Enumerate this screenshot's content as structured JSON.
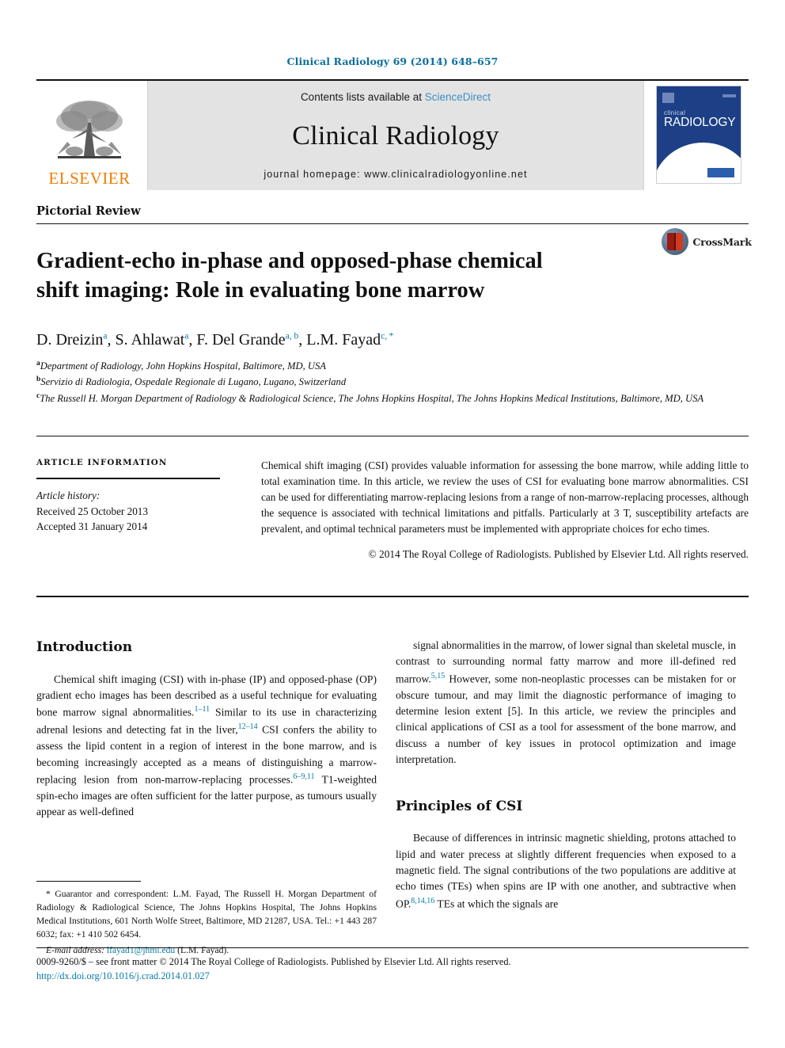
{
  "running_head": "Clinical Radiology 69 (2014) 648–657",
  "masthead": {
    "publisher_word": "ELSEVIER",
    "contents_prefix": "Contents lists available at ",
    "contents_link": "ScienceDirect",
    "journal_name": "Clinical Radiology",
    "homepage": "journal homepage: www.clinicalradiologyonline.net",
    "cover": {
      "small_word": "clinical",
      "big_word": "RADIOLOGY"
    }
  },
  "article": {
    "type": "Pictorial Review",
    "title": "Gradient-echo in-phase and opposed-phase chemical shift imaging: Role in evaluating bone marrow",
    "crossmark_label": "CrossMark",
    "authors_html": "D. Dreizin<sup>a</sup>, S. Ahlawat<sup>a</sup>, F. Del Grande<sup>a, b</sup>, L.M. Fayad<sup>c, *</sup>",
    "affiliations": [
      "Department of Radiology, John Hopkins Hospital, Baltimore, MD, USA",
      "Servizio di Radiologia, Ospedale Regionale di Lugano, Lugano, Switzerland",
      "The Russell H. Morgan Department of Radiology & Radiological Science, The Johns Hopkins Hospital, The Johns Hopkins Medical Institutions, Baltimore, MD, USA"
    ],
    "affiliation_marks": [
      "a",
      "b",
      "c"
    ]
  },
  "article_information": {
    "heading": "ARTICLE INFORMATION",
    "history_label": "Article history:",
    "received": "Received 25 October 2013",
    "accepted": "Accepted 31 January 2014"
  },
  "abstract": {
    "text": "Chemical shift imaging (CSI) provides valuable information for assessing the bone marrow, while adding little to total examination time. In this article, we review the uses of CSI for evaluating bone marrow abnormalities. CSI can be used for differentiating marrow-replacing lesions from a range of non-marrow-replacing processes, although the sequence is associated with technical limitations and pitfalls. Particularly at 3 T, susceptibility artefacts are prevalent, and optimal technical parameters must be implemented with appropriate choices for echo times.",
    "copyright": "© 2014 The Royal College of Radiologists. Published by Elsevier Ltd. All rights reserved."
  },
  "body": {
    "left_column": {
      "heading": "Introduction",
      "paragraph_html": "Chemical shift imaging (CSI) with in-phase (IP) and opposed-phase (OP) gradient echo images has been described as a useful technique for evaluating bone marrow signal abnormalities.<sup class=\"ref\">1–11</sup> Similar to its use in characterizing adrenal lesions and detecting fat in the liver,<sup class=\"ref\">12–14</sup> CSI confers the ability to assess the lipid content in a region of interest in the bone marrow, and is becoming increasingly accepted as a means of distinguishing a marrow-replacing lesion from non-marrow-replacing processes.<sup class=\"ref\">6–9,11</sup> T1-weighted spin-echo images are often sufficient for the latter purpose, as tumours usually appear as well-defined"
    },
    "right_column": {
      "continuation_html": "signal abnormalities in the marrow, of lower signal than skeletal muscle, in contrast to surrounding normal fatty marrow and more ill-defined red marrow.<sup class=\"ref\">5,15</sup> However, some non-neoplastic processes can be mistaken for or obscure tumour, and may limit the diagnostic performance of imaging to determine lesion extent [5]. In this article, we review the principles and clinical applications of CSI as a tool for assessment of the bone marrow, and discuss a number of key issues in protocol optimization and image interpretation.",
      "heading": "Principles of CSI",
      "paragraph_html": "Because of differences in intrinsic magnetic shielding, protons attached to lipid and water precess at slightly different frequencies when exposed to a magnetic field. The signal contributions of the two populations are additive at echo times (TEs) when spins are IP with one another, and subtractive when OP.<sup class=\"ref\">8,14,16</sup> TEs at which the signals are"
    }
  },
  "footnote": {
    "correspondence_html": "* Guarantor and correspondent: L.M. Fayad, The Russell H. Morgan Department of Radiology &amp; Radiological Science, The Johns Hopkins Hospital, The Johns Hopkins Medical Institutions, 601 North Wolfe Street, Baltimore, MD 21287, USA. Tel.: +1 443 287 6032; fax: +1 410 502 6454.",
    "email_label": "E-mail address:",
    "email": "lfayad1@jhmi.edu",
    "email_owner": "(L.M. Fayad)."
  },
  "imprint": {
    "line": "0009-9260/$ – see front matter © 2014 The Royal College of Radiologists. Published by Elsevier Ltd. All rights reserved.",
    "doi": "http://dx.doi.org/10.1016/j.crad.2014.01.027"
  },
  "colors": {
    "link_blue": "#0a7aa8",
    "sciencedirect_blue": "#3d8fc6",
    "elsevier_orange": "#f07d00",
    "cover_blue": "#1c3f86",
    "masthead_grey": "#e3e3e3"
  }
}
